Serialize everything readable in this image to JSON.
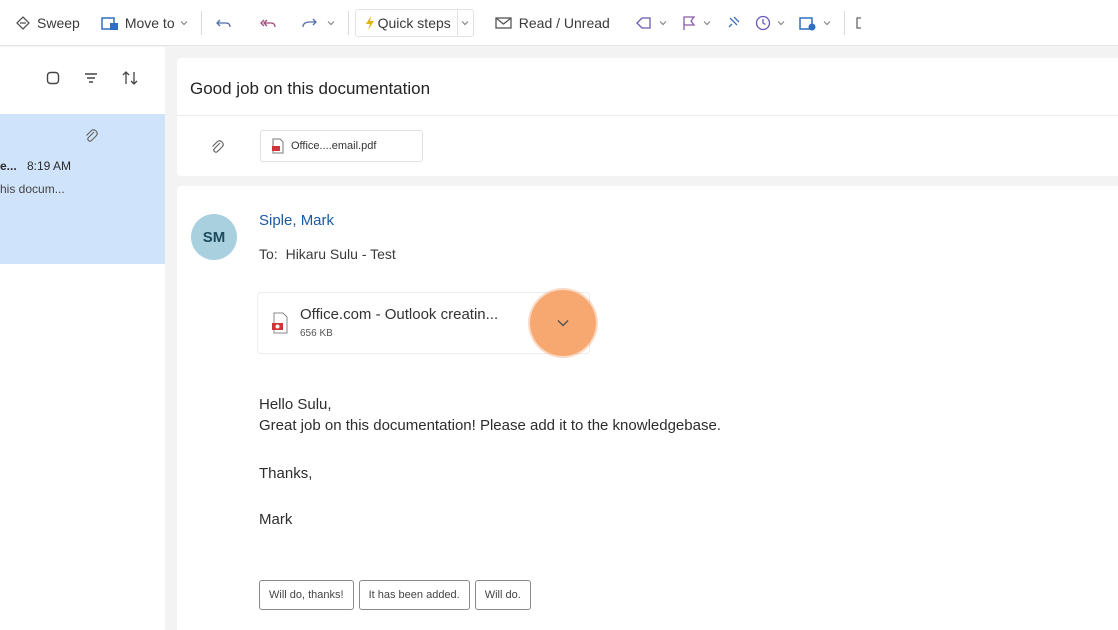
{
  "ribbon": {
    "sweep_label": "Sweep",
    "move_to_label": "Move to",
    "quick_steps_label": "Quick steps",
    "read_unread_label": "Read / Unread"
  },
  "message_list": {
    "selected_item": {
      "sender_fragment": "e...",
      "time": "8:19 AM",
      "subject_fragment": "his docum..."
    }
  },
  "reading_pane": {
    "subject": "Good job on this documentation",
    "header_attachment_name": "Office....email.pdf",
    "message": {
      "avatar_initials": "SM",
      "from_name": "Siple, Mark",
      "to_label": "To:",
      "to_value": "Hikaru Sulu - Test",
      "attachment": {
        "name": "Office.com - Outlook creatin...",
        "size": "656 KB"
      },
      "body": {
        "greeting": "Hello Sulu,",
        "line1": "Great job on this documentation! Please add it to the knowledgebase.",
        "closing": "Thanks,",
        "signature": "Mark"
      },
      "suggested_replies": [
        "Will do, thanks!",
        "It has been added.",
        "Will do."
      ]
    }
  },
  "colors": {
    "accent_blue": "#1b5aa6",
    "selection": "#cfe4fa",
    "avatar_bg": "#a8d0de",
    "highlight_orange": "#f69c5c"
  }
}
